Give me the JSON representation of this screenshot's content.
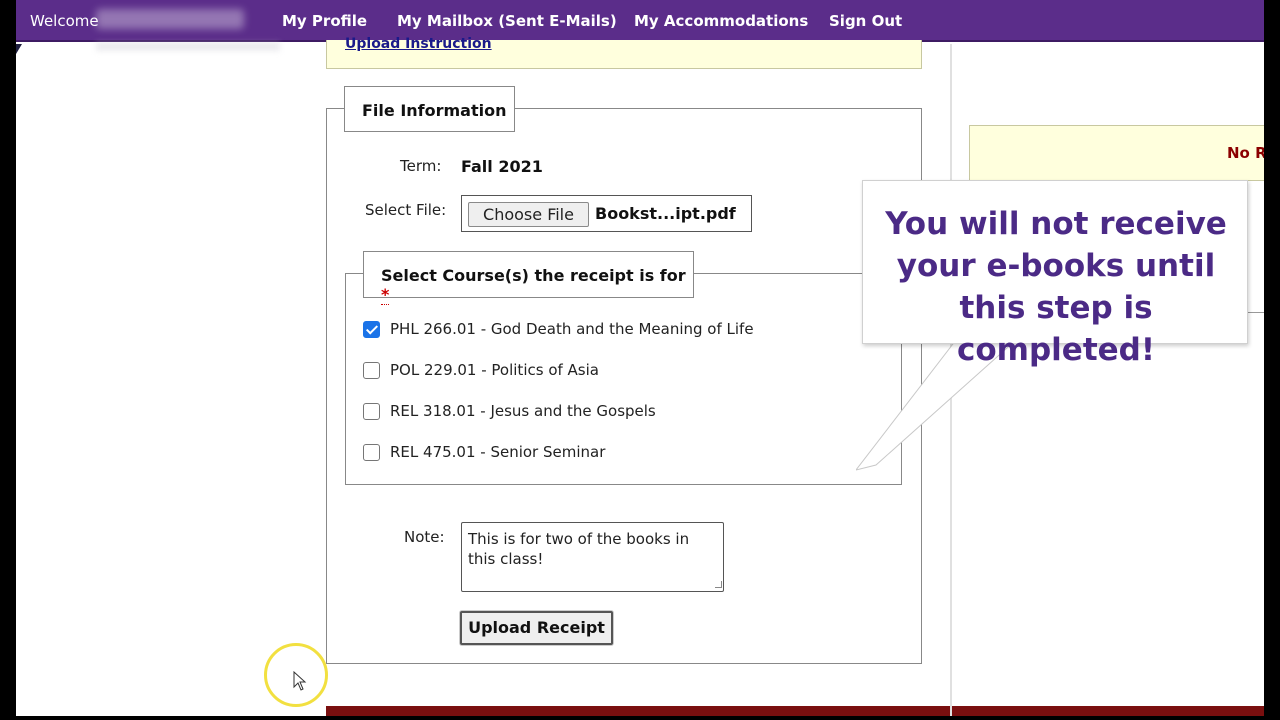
{
  "nav": {
    "welcome": "Welcome",
    "items": [
      "My Profile",
      "My Mailbox (Sent E-Mails)",
      "My Accommodations",
      "Sign Out"
    ]
  },
  "instructions": {
    "link": "Upload Instruction"
  },
  "file_info": {
    "legend": "File Information",
    "term_label": "Term:",
    "term_value": "Fall 2021",
    "select_file_label": "Select File:",
    "choose_button": "Choose File",
    "file_name": "Bookst...ipt.pdf"
  },
  "courses": {
    "legend": "Select Course(s) the receipt is for",
    "required_mark": "*",
    "items": [
      {
        "label": "PHL 266.01 - God Death and the Meaning of Life",
        "checked": true
      },
      {
        "label": "POL 229.01 - Politics of Asia",
        "checked": false
      },
      {
        "label": "REL 318.01 - Jesus and the Gospels",
        "checked": false
      },
      {
        "label": "REL 475.01 - Senior Seminar",
        "checked": false
      }
    ]
  },
  "note": {
    "label": "Note:",
    "value": "This is for two of the books in this class!"
  },
  "upload_button": "Upload Receipt",
  "right_panel": {
    "text": "No R"
  },
  "callout": {
    "line1": "You will not receive",
    "line2": "your e-books until",
    "line3": "this step is completed!",
    "color": "#4b2a86"
  },
  "colors": {
    "nav": "#5b2d8a",
    "accent_bar": "#7a0f0f",
    "highlight_bg": "#ffffdd"
  }
}
